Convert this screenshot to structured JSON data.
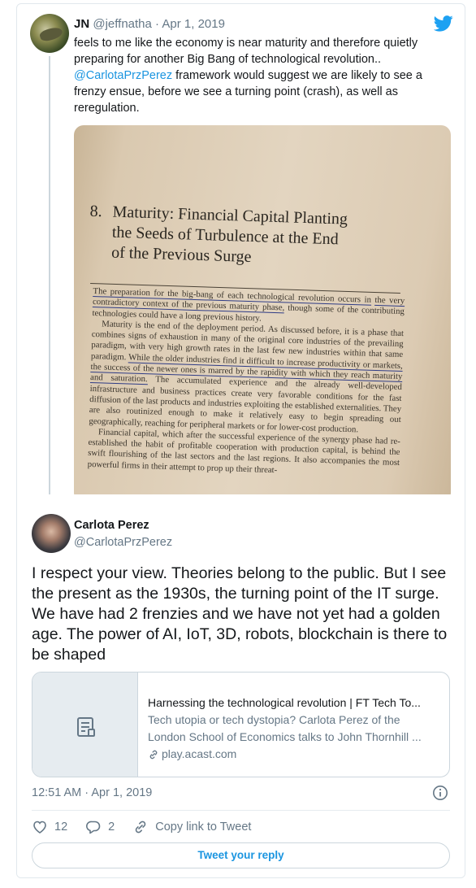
{
  "parent": {
    "name": "JN",
    "handle": "@jeffnatha",
    "separator": "·",
    "date": "Apr 1, 2019",
    "text_before_mention": "feels to me like the economy is near maturity and therefore quietly preparing for another Big Bang of technological revolution.. ",
    "mention": "@CarlotaPrzPerez",
    "text_after_mention": " framework would suggest we are likely to see a frenzy ensue, before we see a turning point (crash), as well as reregulation.",
    "photo": {
      "chapter_number": "8.",
      "chapter_title_lines": [
        "Maturity: Financial Capital Planting",
        "the Seeds of Turbulence at the End",
        "of the Previous Surge"
      ],
      "p1_a": "The preparation for the big-bang of each technological revolution occurs in",
      "p1_b": "the very contradictory context of the previous maturity phase,",
      "p1_c": " though some of the contributing technologies could have a long previous history.",
      "p2_a": "Maturity is the end of the deployment period. As discussed before, it is a phase that combines signs of exhaustion in many of the original core industries of the prevailing paradigm, with very high growth rates in the last few new industries within that same paradigm. ",
      "p2_b": "While the older industries find it difficult to increase productivity or markets, the success of the newer ones is marred by the rapidity with which they reach maturity and saturation.",
      "p2_c": " The accumulated experience and the already well-developed infrastructure and business practices create very favorable conditions for the fast diffusion of the last products and industries exploiting the established externalities. They are also routinized enough to make it relatively easy to begin spreading out geographically, reaching for peripheral markets or for lower-cost production.",
      "p3": "Financial capital, which after the successful experience of the synergy phase had re-established the habit of profitable cooperation with production capital, is behind the swift flourishing of the last sectors and the last regions. It also accompanies the most powerful firms in their attempt to prop up their threat-"
    }
  },
  "reply": {
    "name": "Carlota Perez",
    "handle": "@CarlotaPrzPerez",
    "text": "I respect your view. Theories belong to the public. But I see the present as the 1930s, the turning point of the IT surge. We have had 2 frenzies and we have not yet had a golden age. The power of AI, IoT, 3D, robots, blockchain is there to be shaped",
    "card": {
      "title": "Harnessing the technological revolution | FT Tech To...",
      "description": "Tech utopia or tech dystopia? Carlota Perez of the London School of Economics talks to John Thornhill ...",
      "domain": "play.acast.com"
    },
    "timestamp": "12:51 AM · Apr 1, 2019",
    "likes": "12",
    "replies": "2",
    "copy_link": "Copy link to Tweet",
    "reply_button": "Tweet your reply"
  },
  "icons": {
    "brand": "twitter-bird-icon",
    "brand_color": "#1da1f2",
    "link_color": "#1b95e0",
    "muted_color": "#657786"
  }
}
